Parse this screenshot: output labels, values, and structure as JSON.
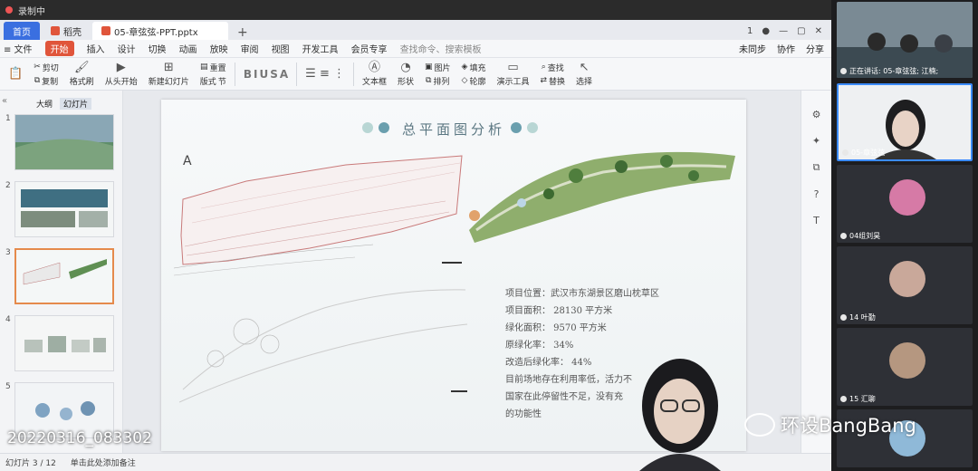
{
  "recording": {
    "label": "录制中"
  },
  "tabs": [
    {
      "label": "首页"
    },
    {
      "label": "稻壳"
    },
    {
      "label": "05-章弦弦-PPT.pptx"
    }
  ],
  "tab_right": [
    "1",
    "●"
  ],
  "menu": {
    "file": "≡ 文件",
    "items": [
      "开始",
      "插入",
      "设计",
      "切换",
      "动画",
      "放映",
      "审阅",
      "视图",
      "开发工具",
      "会员专享"
    ],
    "active": "开始",
    "search_placeholder": "查找命令、搜索模板",
    "right": [
      "未同步",
      "协作",
      "分享"
    ]
  },
  "ribbon": {
    "cut": "剪切",
    "copy": "复制",
    "format_painter": "格式刷",
    "from_start": "从头开始",
    "new_slide": "新建幻灯片",
    "layout": "版式",
    "section": "节",
    "reset": "重置",
    "textbox": "文本框",
    "shape": "形状",
    "arrange": "排列",
    "picture": "图片",
    "fill": "填充",
    "outline": "轮廓",
    "present_tools": "演示工具",
    "find": "查找",
    "replace": "替换",
    "select": "选择"
  },
  "left_panel": {
    "tab_outline": "大纲",
    "tab_slides": "幻灯片"
  },
  "thumbnails": [
    {
      "num": "1"
    },
    {
      "num": "2"
    },
    {
      "num": "3"
    },
    {
      "num": "4"
    },
    {
      "num": "5"
    }
  ],
  "slide": {
    "title": "总平面图分析",
    "north_label": "A",
    "info": [
      "项目位置：武汉市东湖景区磨山枕草区",
      "项目面积：  28130 平方米",
      "绿化面积：  9570 平方米",
      "原绿化率：  34%",
      "改造后绿化率：  44%",
      "目前场地存在利用率低，活力不",
      "国家在此停留性不足，没有充",
      "的功能性"
    ]
  },
  "status": {
    "slide_count": "幻灯片 3 / 12",
    "note": "单击此处添加备注"
  },
  "participants": [
    {
      "name": "正在讲话: 05-章弦弦; 江楠;"
    },
    {
      "name": "05-章弦弦"
    },
    {
      "name": "04组刘昊"
    },
    {
      "name": "14 叶勤"
    },
    {
      "name": "15 汇聊"
    },
    {
      "name": ""
    }
  ],
  "overlay": {
    "timestamp": "20220316_083302",
    "watermark": "环设BangBang"
  },
  "colors": {
    "accent": "#e0553b",
    "home_tab": "#3a6fe0",
    "title": "#5b7782",
    "speaker_border": "#3b8bff"
  }
}
